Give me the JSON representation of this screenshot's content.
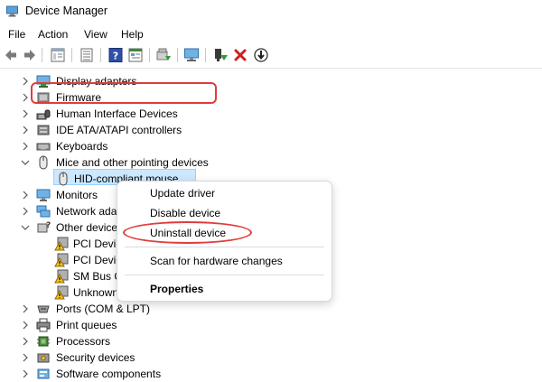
{
  "window": {
    "title": "Device Manager"
  },
  "menu": [
    "File",
    "Action",
    "View",
    "Help"
  ],
  "toolbar_icons": [
    "back-icon",
    "forward-icon",
    "properties-icon",
    "list-icon",
    "help-icon",
    "details-icon",
    "update-driver-icon",
    "scan-icon",
    "enable-icon",
    "uninstall-icon",
    "download-icon"
  ],
  "tree": {
    "items": [
      {
        "label": "Display adapters",
        "icon": "display-adapter-icon",
        "expanded": false
      },
      {
        "label": "Firmware",
        "icon": "firmware-icon",
        "expanded": false
      },
      {
        "label": "Human Interface Devices",
        "icon": "hid-icon",
        "expanded": false
      },
      {
        "label": "IDE ATA/ATAPI controllers",
        "icon": "ide-icon",
        "expanded": false
      },
      {
        "label": "Keyboards",
        "icon": "keyboard-icon",
        "expanded": false
      },
      {
        "label": "Mice and other pointing devices",
        "icon": "mouse-icon",
        "expanded": true
      },
      {
        "label": "HID-compliant mouse",
        "icon": "mouse-icon",
        "child": true,
        "selected": true
      },
      {
        "label": "Monitors",
        "icon": "monitor-icon",
        "expanded": false
      },
      {
        "label": "Network ada",
        "icon": "network-icon",
        "expanded": false
      },
      {
        "label": "Other device",
        "icon": "other-devices-icon",
        "expanded": true
      },
      {
        "label": "PCI Devic",
        "icon": "warning-device-icon",
        "child": true
      },
      {
        "label": "PCI Devic",
        "icon": "warning-device-icon",
        "child": true
      },
      {
        "label": "SM Bus C",
        "icon": "warning-device-icon",
        "child": true
      },
      {
        "label": "Unknown",
        "icon": "warning-device-icon",
        "child": true
      },
      {
        "label": "Ports (COM & LPT)",
        "icon": "port-icon",
        "expanded": false
      },
      {
        "label": "Print queues",
        "icon": "printer-icon",
        "expanded": false
      },
      {
        "label": "Processors",
        "icon": "processor-icon",
        "expanded": false
      },
      {
        "label": "Security devices",
        "icon": "security-icon",
        "expanded": false
      },
      {
        "label": "Software components",
        "icon": "software-icon",
        "expanded": false
      }
    ]
  },
  "context_menu": {
    "update_driver": "Update driver",
    "disable_device": "Disable device",
    "uninstall_device": "Uninstall device",
    "scan": "Scan for hardware changes",
    "properties": "Properties"
  },
  "colors": {
    "annotation_red": "#e03c3c",
    "selection_bg": "#cce8ff",
    "selection_border": "#99d1ff"
  }
}
